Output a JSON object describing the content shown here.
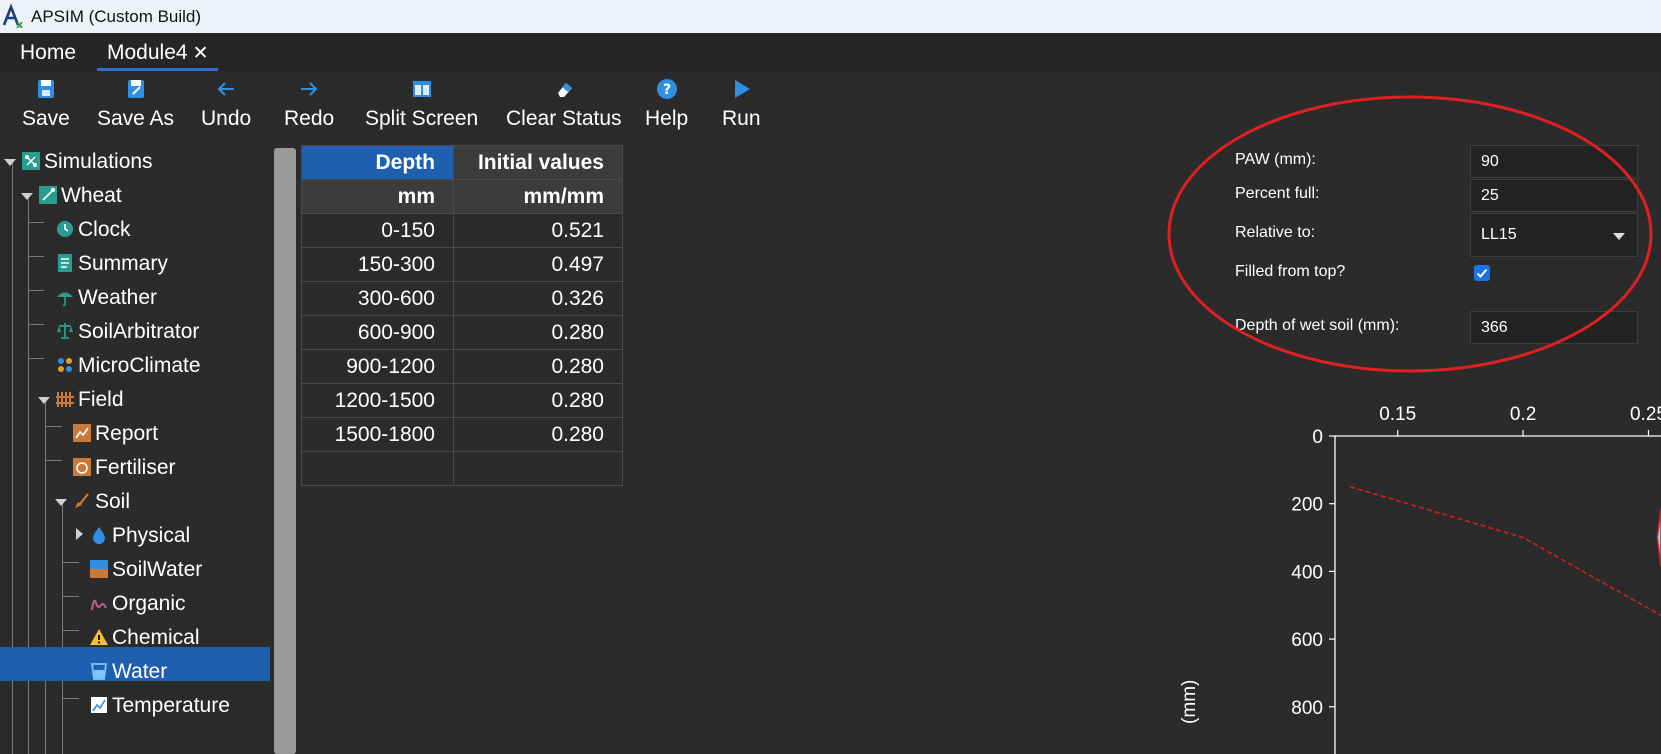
{
  "window": {
    "title": "APSIM (Custom Build)"
  },
  "tabs": [
    {
      "label": "Home"
    },
    {
      "label": "Module4",
      "close": "✕"
    }
  ],
  "toolbar": [
    {
      "label": "Save",
      "icon": "save-icon"
    },
    {
      "label": "Save As",
      "icon": "save-as-icon"
    },
    {
      "label": "Undo",
      "icon": "undo-icon"
    },
    {
      "label": "Redo",
      "icon": "redo-icon"
    },
    {
      "label": "Split Screen",
      "icon": "split-screen-icon"
    },
    {
      "label": "Clear Status",
      "icon": "eraser-icon"
    },
    {
      "label": "Help",
      "icon": "help-icon"
    },
    {
      "label": "Run",
      "icon": "run-icon"
    }
  ],
  "tree": [
    {
      "label": "Simulations",
      "icon": "simulations-icon",
      "expanded": true
    },
    {
      "label": "Wheat",
      "icon": "wheat-icon",
      "expanded": true
    },
    {
      "label": "Clock",
      "icon": "clock-icon"
    },
    {
      "label": "Summary",
      "icon": "summary-icon"
    },
    {
      "label": "Weather",
      "icon": "weather-icon"
    },
    {
      "label": "SoilArbitrator",
      "icon": "soil-arbitrator-icon"
    },
    {
      "label": "MicroClimate",
      "icon": "microclimate-icon"
    },
    {
      "label": "Field",
      "icon": "field-icon",
      "expanded": true
    },
    {
      "label": "Report",
      "icon": "report-icon"
    },
    {
      "label": "Fertiliser",
      "icon": "fertiliser-icon"
    },
    {
      "label": "Soil",
      "icon": "soil-icon",
      "expanded": true
    },
    {
      "label": "Physical",
      "icon": "physical-icon",
      "expanded": false
    },
    {
      "label": "SoilWater",
      "icon": "soilwater-icon"
    },
    {
      "label": "Organic",
      "icon": "organic-icon"
    },
    {
      "label": "Chemical",
      "icon": "chemical-icon"
    },
    {
      "label": "Water",
      "icon": "water-icon",
      "selected": true
    },
    {
      "label": "Temperature",
      "icon": "temperature-icon"
    }
  ],
  "grid": {
    "headers": [
      "Depth",
      "Initial values"
    ],
    "units": [
      "mm",
      "mm/mm"
    ],
    "rows": [
      [
        "0-150",
        "0.521"
      ],
      [
        "150-300",
        "0.497"
      ],
      [
        "300-600",
        "0.326"
      ],
      [
        "600-900",
        "0.280"
      ],
      [
        "900-1200",
        "0.280"
      ],
      [
        "1200-1500",
        "0.280"
      ],
      [
        "1500-1800",
        "0.280"
      ],
      [
        "",
        ""
      ]
    ]
  },
  "form": {
    "paw_label": "PAW (mm):",
    "paw_value": "90",
    "percent_label": "Percent full:",
    "percent_value": "25",
    "relative_label": "Relative to:",
    "relative_value": "LL15",
    "filled_label": "Filled from top?",
    "filled_checked": true,
    "depth_label": "Depth of wet soil (mm):",
    "depth_value": "366"
  },
  "annotation": {
    "shape": "ellipse",
    "color": "#e02020"
  },
  "chart_data": {
    "type": "line",
    "xlabel": "",
    "ylabel": "(mm)",
    "x_ticks": [
      "0.15",
      "0.2",
      "0.25"
    ],
    "y_ticks": [
      "0",
      "200",
      "400",
      "600",
      "800"
    ],
    "x_axis_position": "top",
    "y_reversed": true,
    "xlim": [
      0.125,
      0.255
    ],
    "ylim": [
      0,
      900
    ],
    "series": [
      {
        "style": "dashed",
        "color": "#d02020",
        "points": [
          [
            0.131,
            150
          ],
          [
            0.2,
            300
          ],
          [
            0.255,
            530
          ]
        ]
      }
    ],
    "polygon_partial": {
      "fill": "#9ed0f0",
      "stroke": "#d02020",
      "points": [
        [
          0.255,
          215
        ],
        [
          0.2535,
          300
        ],
        [
          0.255,
          385
        ]
      ]
    }
  }
}
